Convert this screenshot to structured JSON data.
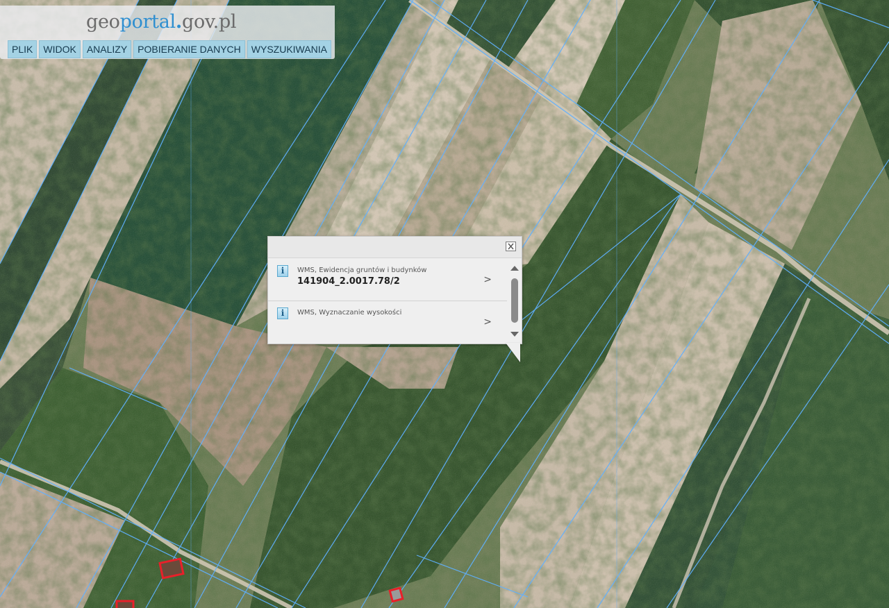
{
  "header": {
    "logo": {
      "geo": "geo",
      "portal": "portal",
      "dot": ".",
      "gov": "gov.pl"
    },
    "menu": [
      "PLIK",
      "WIDOK",
      "ANALIZY",
      "POBIERANIE DANYCH",
      "WYSZUKIWANIA"
    ]
  },
  "popup": {
    "results": [
      {
        "source": "WMS, Ewidencja gruntów i budynków",
        "value": "141904_2.0017.78/2"
      },
      {
        "source": "WMS, Wyznaczanie wysokości",
        "value": ""
      }
    ],
    "chevron": ">"
  },
  "colors": {
    "menu_bg": "#a4d2e4",
    "parcel_line": "#5fb0ff",
    "building_outline": "#e8202a"
  }
}
